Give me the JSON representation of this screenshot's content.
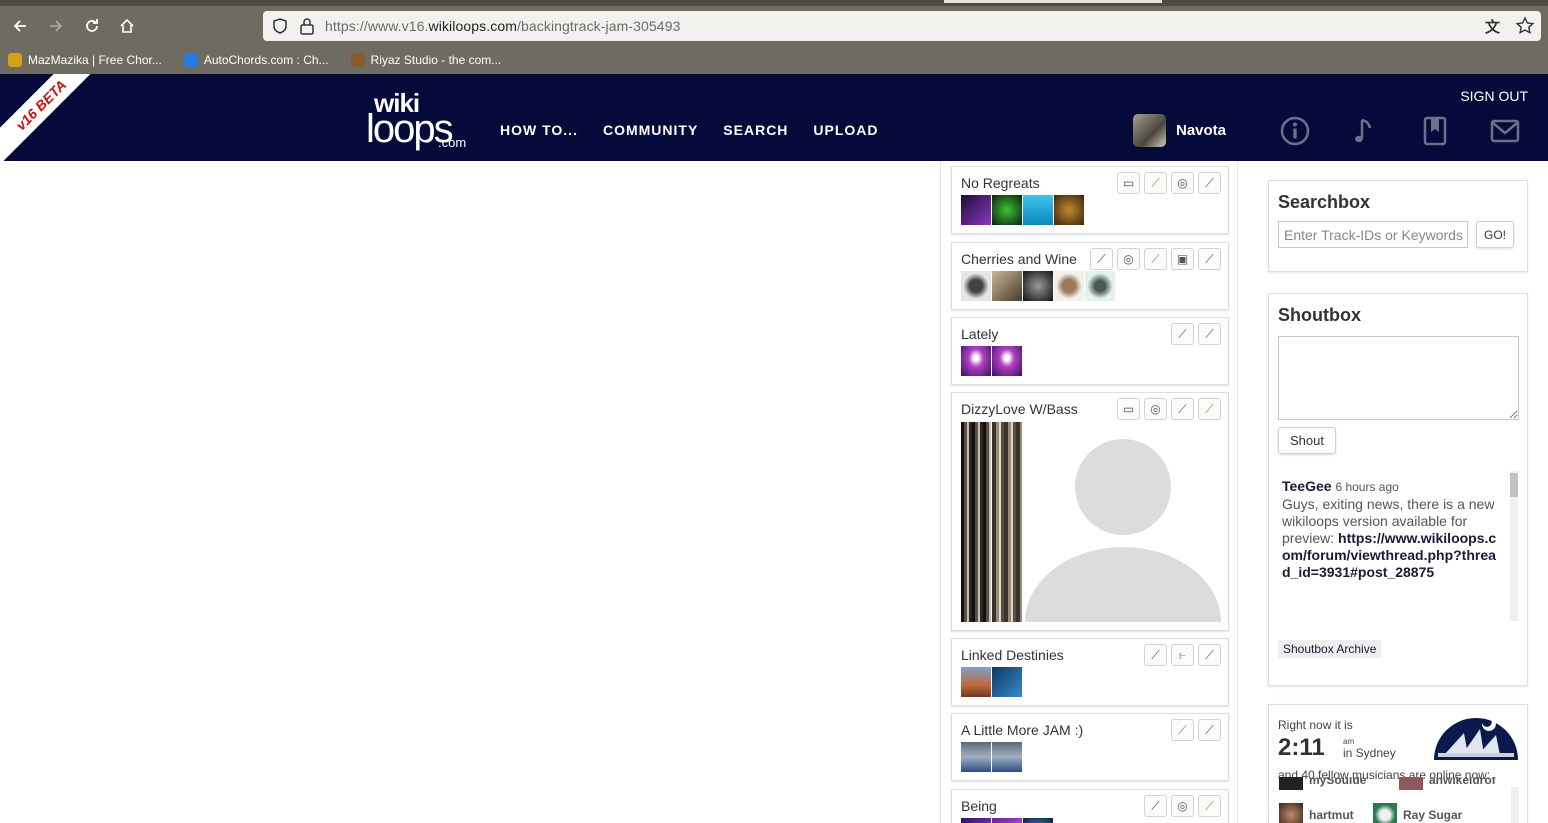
{
  "browser": {
    "url_prefix": "https://www.v16.",
    "url_domain": "wikiloops.com",
    "url_path": "/backingtrack-jam-305493",
    "bookmarks": [
      {
        "label": "MazMazika | Free Chor...",
        "color": "#d4a017"
      },
      {
        "label": "AutoChords.com : Ch...",
        "color": "#2a7ae2"
      },
      {
        "label": "Riyaz Studio - the com...",
        "color": "#8a5a2b"
      }
    ]
  },
  "header": {
    "beta_label": "v16 BETA",
    "logo_wiki": "wiki",
    "logo_loops": "loops",
    "logo_com": ".com",
    "nav": [
      "HOW TO...",
      "COMMUNITY",
      "SEARCH",
      "UPLOAD"
    ],
    "sign_out": "SIGN OUT",
    "username": "Navota"
  },
  "tracks": [
    {
      "title": "No Regreats",
      "instruments": [
        "keys-icon",
        "guitar-icon",
        "drums-icon",
        "electric-guitar-icon"
      ],
      "thumb_colors": [
        "#5b2d7a",
        "#2f7a2a",
        "#28a6d8",
        "#7a4a14"
      ]
    },
    {
      "title": "Cherries and Wine",
      "instruments": [
        "bass-icon",
        "drums-icon",
        "guitar-icon",
        "video-icon",
        "electric-guitar-icon"
      ],
      "thumb_colors": [
        "#d8d8d8",
        "#6b5a45",
        "#2b2b2b",
        "#e8e0d8",
        "#cfe6dc"
      ]
    },
    {
      "title": "Lately",
      "instruments": [
        "electric-guitar-icon",
        "bass-icon"
      ],
      "thumb_colors": [
        "#7a2b8a",
        "#7a2b8a"
      ]
    },
    {
      "title": "DizzyLove W/Bass",
      "instruments": [
        "keys-icon",
        "drums-icon",
        "electric-guitar-icon",
        "guitar-icon"
      ],
      "thumb_colors": [
        "#3a3530",
        "#8a7a6a"
      ]
    },
    {
      "title": "Linked Destinies",
      "instruments": [
        "electric-guitar-icon",
        "brass-icon",
        "electric-guitar-icon"
      ],
      "thumb_colors": [
        "#a45a3a",
        "#1e5a8a"
      ]
    },
    {
      "title": "A Little More JAM :)",
      "instruments": [
        "guitar-icon",
        "bass-icon"
      ],
      "thumb_colors": [
        "#6a7a8a",
        "#6a7a8a"
      ]
    },
    {
      "title": "Being",
      "instruments": [
        "electric-guitar-icon",
        "drums-icon",
        "guitar-icon"
      ],
      "thumb_colors": [
        "#5a3a8a",
        "#7a3aa0",
        "#1e4a7a"
      ]
    }
  ],
  "searchbox": {
    "title": "Searchbox",
    "placeholder": "Enter Track-IDs or Keywords",
    "go_label": "GO!"
  },
  "shoutbox": {
    "title": "Shoutbox",
    "shout_label": "Shout",
    "message": {
      "author": "TeeGee",
      "time": "6 hours ago",
      "text": "Guys, exiting news, there is a new wikiloops version available for preview:",
      "link": "https://www.wikiloops.com/forum/viewthread.php?thread_id=3931#post_28875"
    },
    "archive_label": "Shoutbox Archive"
  },
  "clock": {
    "right_now": "Right now it is",
    "time": "2:11",
    "ampm": "am",
    "city": "in Sydney",
    "online": "and 40 fellow musicians are online now:",
    "musicians": [
      {
        "name": "mySoulde"
      },
      {
        "name": "anwikeldrof"
      },
      {
        "name": "hartmut"
      },
      {
        "name": "Ray Sugar"
      }
    ]
  }
}
